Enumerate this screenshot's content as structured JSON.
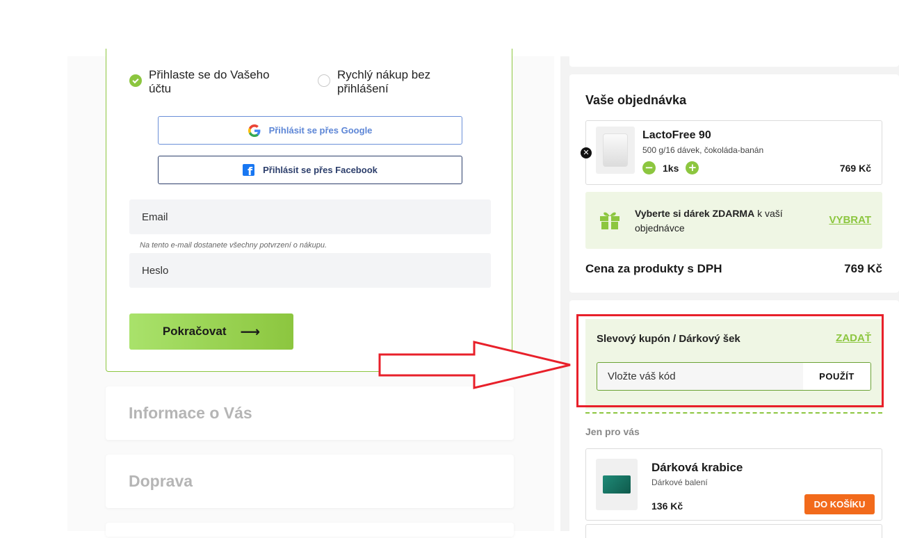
{
  "login": {
    "options": [
      {
        "label": "Přihlaste se do Vašeho účtu",
        "selected": true
      },
      {
        "label": "Rychlý nákup bez přihlášení",
        "selected": false
      }
    ],
    "google_label": "Přihlásit se přes Google",
    "facebook_label": "Přihlásit se přes Facebook",
    "email_placeholder": "Email",
    "email_hint": "Na tento e-mail dostanete všechny potvrzení o nákupu.",
    "password_placeholder": "Heslo",
    "continue_label": "Pokračovat",
    "continue_arrow": "⟶"
  },
  "steps": {
    "info": "Informace o Vás",
    "shipping": "Doprava"
  },
  "order": {
    "title": "Vaše objednávka",
    "product": {
      "name": "LactoFree 90",
      "variant": "500 g/16 dávek, čokoláda-banán",
      "quantity": "1ks",
      "price": "769 Kč"
    },
    "gift": {
      "text_bold": "Vyberte si dárek ZDARMA",
      "text_rest": " k vaší objednávce",
      "action": "VYBRAT"
    },
    "total_label": "Cena za produkty s DPH",
    "total_value": "769 Kč"
  },
  "coupon": {
    "title": "Slevový kupón / Dárkový šek",
    "action": "ZADAŤ",
    "placeholder": "Vložte váš kód",
    "apply": "POUŽÍT"
  },
  "upsell": {
    "section_label": "Jen pro vás",
    "name": "Dárková krabice",
    "subtitle": "Dárkové balení",
    "price": "136 Kč",
    "button": "DO KOŠÍKU"
  },
  "colors": {
    "accent": "#8cc63f",
    "highlight": "#e8202a",
    "cta_orange": "#f26a1b"
  }
}
